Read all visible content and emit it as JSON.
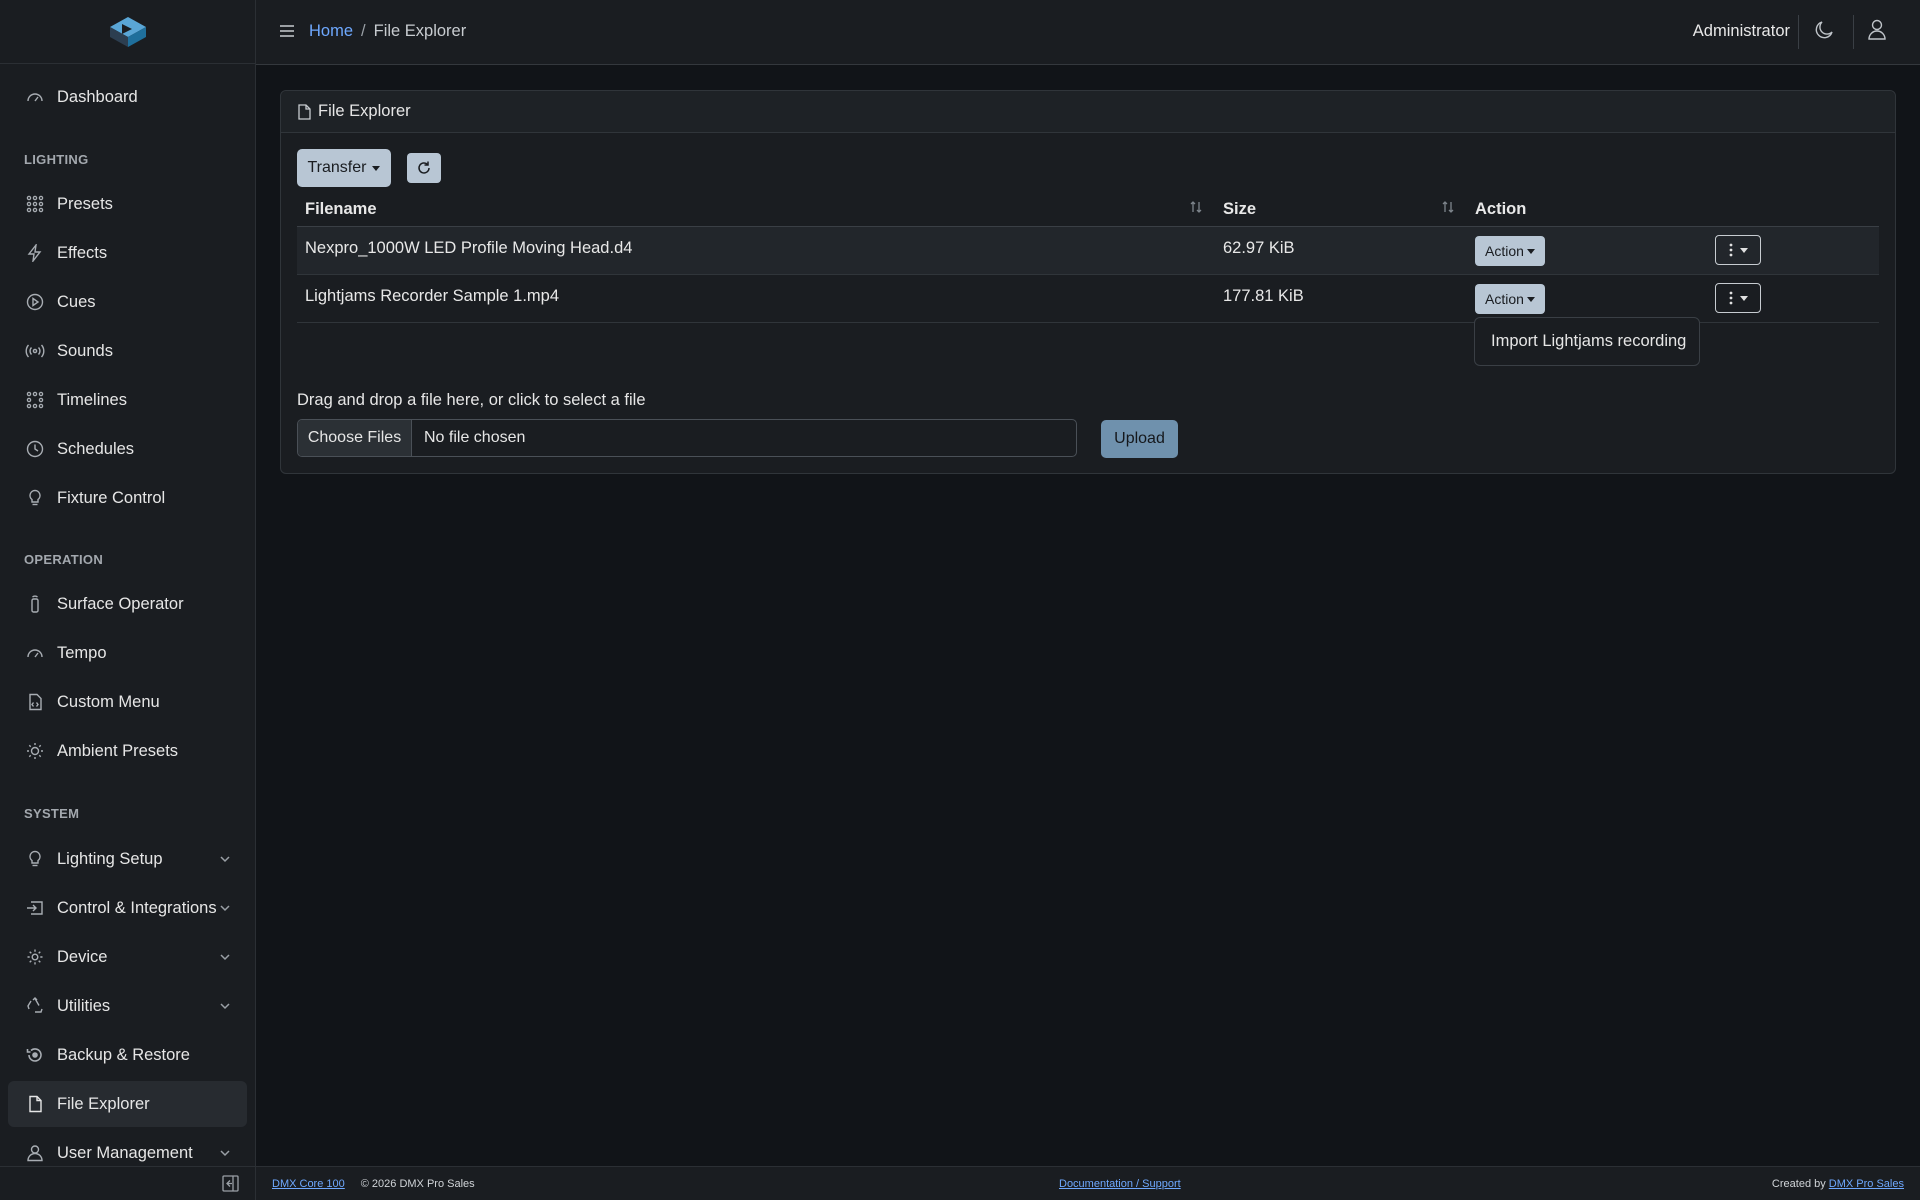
{
  "sidebar": {
    "dashboard": "Dashboard",
    "sections": {
      "lighting": "LIGHTING",
      "operation": "OPERATION",
      "system": "SYSTEM"
    },
    "lighting_items": [
      "Presets",
      "Effects",
      "Cues",
      "Sounds",
      "Timelines",
      "Schedules",
      "Fixture Control"
    ],
    "operation_items": [
      "Surface Operator",
      "Tempo",
      "Custom Menu",
      "Ambient Presets"
    ],
    "system_items": [
      "Lighting Setup",
      "Control & Integrations",
      "Device",
      "Utilities",
      "Backup & Restore",
      "File Explorer",
      "User Management"
    ],
    "active_item": "File Explorer"
  },
  "header": {
    "breadcrumb_home": "Home",
    "breadcrumb_sep": "/",
    "breadcrumb_current": "File Explorer",
    "user": "Administrator"
  },
  "card": {
    "title": "File Explorer",
    "transfer_label": "Transfer",
    "columns": {
      "filename": "Filename",
      "size": "Size",
      "action": "Action"
    },
    "rows": [
      {
        "filename": "Nexpro_1000W LED Profile Moving Head.d4",
        "size": "62.97 KiB",
        "action": "Action"
      },
      {
        "filename": "Lightjams Recorder Sample 1.mp4",
        "size": "177.81 KiB",
        "action": "Action"
      }
    ],
    "dropdown_item": "Import Lightjams recording",
    "drop_text": "Drag and drop a file here, or click to select a file",
    "choose_files": "Choose Files",
    "no_file": "No file chosen",
    "upload_label": "Upload"
  },
  "footer": {
    "product_link": "DMX Core 100",
    "copyright": "© 2026 DMX Pro Sales",
    "docs_link": "Documentation / Support",
    "created_by": "Created by",
    "creator_link": "DMX Pro Sales"
  },
  "colors": {
    "background": "#111418",
    "panel": "#1a1d21",
    "link": "#6ea8fe",
    "button": "#b8c6d4",
    "upload_button": "#6f91ad"
  }
}
